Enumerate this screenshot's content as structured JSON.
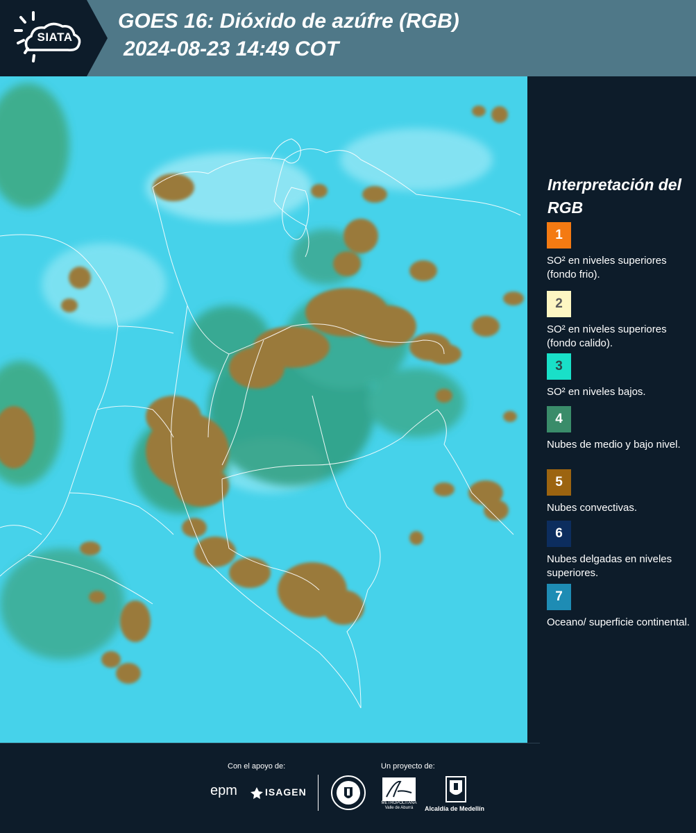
{
  "header": {
    "logo_text": "SIATA",
    "title_line1": "GOES 16: Dióxido de azúfre (RGB)",
    "title_line2": "2024-08-23 14:49 COT",
    "icon": "sun-cloud-logo"
  },
  "map": {
    "product": "GOES 16 SO2 RGB",
    "background_color": "#46d2ea",
    "convective_color": "#9a7a3a",
    "low_cloud_color": "#2e9a78",
    "boundary_color": "#ffffff"
  },
  "legend": {
    "title": "Interpretación del RGB",
    "items": [
      {
        "number": "1",
        "label": "SO² en niveles superiores (fondo frio).",
        "color": "#f47a12",
        "text_color": "#ffffff"
      },
      {
        "number": "2",
        "label": "SO² en niveles superiores (fondo calido).",
        "color": "#fdf6c2",
        "text_color": "#5a5a5a"
      },
      {
        "number": "3",
        "label": "SO² en niveles bajos.",
        "color": "#19e0c8",
        "text_color": "#2a4a4a"
      },
      {
        "number": "4",
        "label": "Nubes de medio y bajo nivel.",
        "color": "#3a8c6a",
        "text_color": "#ffffff"
      },
      {
        "number": "5",
        "label": "Nubes convectivas.",
        "color": "#9c6410",
        "text_color": "#ffffff"
      },
      {
        "number": "6",
        "label": "Nubes delgadas en niveles superiores.",
        "color": "#0c2d5e",
        "text_color": "#ffffff"
      },
      {
        "number": "7",
        "label": "Oceano/ superficie continental.",
        "color": "#1e8cb4",
        "text_color": "#ffffff"
      }
    ]
  },
  "footer": {
    "support_label": "Con el apoyo de:",
    "project_label": "Un proyecto de:",
    "sponsor_1": "epm",
    "sponsor_2": "ISAGEN",
    "partner_metro": "METROPOLITANA Valle de Aburrá",
    "partner_alcaldia": "Alcaldía de Medellín"
  }
}
